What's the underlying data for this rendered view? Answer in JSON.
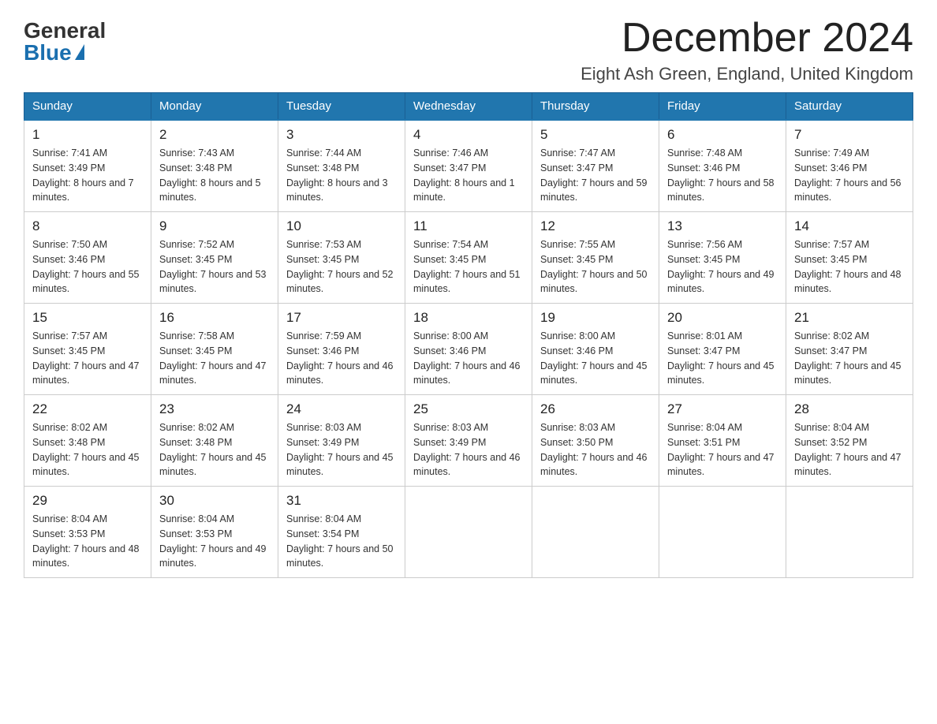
{
  "header": {
    "logo_general": "General",
    "logo_blue": "Blue",
    "month_title": "December 2024",
    "location": "Eight Ash Green, England, United Kingdom"
  },
  "days_of_week": [
    "Sunday",
    "Monday",
    "Tuesday",
    "Wednesday",
    "Thursday",
    "Friday",
    "Saturday"
  ],
  "weeks": [
    [
      {
        "day": "1",
        "sunrise": "7:41 AM",
        "sunset": "3:49 PM",
        "daylight": "8 hours and 7 minutes."
      },
      {
        "day": "2",
        "sunrise": "7:43 AM",
        "sunset": "3:48 PM",
        "daylight": "8 hours and 5 minutes."
      },
      {
        "day": "3",
        "sunrise": "7:44 AM",
        "sunset": "3:48 PM",
        "daylight": "8 hours and 3 minutes."
      },
      {
        "day": "4",
        "sunrise": "7:46 AM",
        "sunset": "3:47 PM",
        "daylight": "8 hours and 1 minute."
      },
      {
        "day": "5",
        "sunrise": "7:47 AM",
        "sunset": "3:47 PM",
        "daylight": "7 hours and 59 minutes."
      },
      {
        "day": "6",
        "sunrise": "7:48 AM",
        "sunset": "3:46 PM",
        "daylight": "7 hours and 58 minutes."
      },
      {
        "day": "7",
        "sunrise": "7:49 AM",
        "sunset": "3:46 PM",
        "daylight": "7 hours and 56 minutes."
      }
    ],
    [
      {
        "day": "8",
        "sunrise": "7:50 AM",
        "sunset": "3:46 PM",
        "daylight": "7 hours and 55 minutes."
      },
      {
        "day": "9",
        "sunrise": "7:52 AM",
        "sunset": "3:45 PM",
        "daylight": "7 hours and 53 minutes."
      },
      {
        "day": "10",
        "sunrise": "7:53 AM",
        "sunset": "3:45 PM",
        "daylight": "7 hours and 52 minutes."
      },
      {
        "day": "11",
        "sunrise": "7:54 AM",
        "sunset": "3:45 PM",
        "daylight": "7 hours and 51 minutes."
      },
      {
        "day": "12",
        "sunrise": "7:55 AM",
        "sunset": "3:45 PM",
        "daylight": "7 hours and 50 minutes."
      },
      {
        "day": "13",
        "sunrise": "7:56 AM",
        "sunset": "3:45 PM",
        "daylight": "7 hours and 49 minutes."
      },
      {
        "day": "14",
        "sunrise": "7:57 AM",
        "sunset": "3:45 PM",
        "daylight": "7 hours and 48 minutes."
      }
    ],
    [
      {
        "day": "15",
        "sunrise": "7:57 AM",
        "sunset": "3:45 PM",
        "daylight": "7 hours and 47 minutes."
      },
      {
        "day": "16",
        "sunrise": "7:58 AM",
        "sunset": "3:45 PM",
        "daylight": "7 hours and 47 minutes."
      },
      {
        "day": "17",
        "sunrise": "7:59 AM",
        "sunset": "3:46 PM",
        "daylight": "7 hours and 46 minutes."
      },
      {
        "day": "18",
        "sunrise": "8:00 AM",
        "sunset": "3:46 PM",
        "daylight": "7 hours and 46 minutes."
      },
      {
        "day": "19",
        "sunrise": "8:00 AM",
        "sunset": "3:46 PM",
        "daylight": "7 hours and 45 minutes."
      },
      {
        "day": "20",
        "sunrise": "8:01 AM",
        "sunset": "3:47 PM",
        "daylight": "7 hours and 45 minutes."
      },
      {
        "day": "21",
        "sunrise": "8:02 AM",
        "sunset": "3:47 PM",
        "daylight": "7 hours and 45 minutes."
      }
    ],
    [
      {
        "day": "22",
        "sunrise": "8:02 AM",
        "sunset": "3:48 PM",
        "daylight": "7 hours and 45 minutes."
      },
      {
        "day": "23",
        "sunrise": "8:02 AM",
        "sunset": "3:48 PM",
        "daylight": "7 hours and 45 minutes."
      },
      {
        "day": "24",
        "sunrise": "8:03 AM",
        "sunset": "3:49 PM",
        "daylight": "7 hours and 45 minutes."
      },
      {
        "day": "25",
        "sunrise": "8:03 AM",
        "sunset": "3:49 PM",
        "daylight": "7 hours and 46 minutes."
      },
      {
        "day": "26",
        "sunrise": "8:03 AM",
        "sunset": "3:50 PM",
        "daylight": "7 hours and 46 minutes."
      },
      {
        "day": "27",
        "sunrise": "8:04 AM",
        "sunset": "3:51 PM",
        "daylight": "7 hours and 47 minutes."
      },
      {
        "day": "28",
        "sunrise": "8:04 AM",
        "sunset": "3:52 PM",
        "daylight": "7 hours and 47 minutes."
      }
    ],
    [
      {
        "day": "29",
        "sunrise": "8:04 AM",
        "sunset": "3:53 PM",
        "daylight": "7 hours and 48 minutes."
      },
      {
        "day": "30",
        "sunrise": "8:04 AM",
        "sunset": "3:53 PM",
        "daylight": "7 hours and 49 minutes."
      },
      {
        "day": "31",
        "sunrise": "8:04 AM",
        "sunset": "3:54 PM",
        "daylight": "7 hours and 50 minutes."
      },
      null,
      null,
      null,
      null
    ]
  ]
}
